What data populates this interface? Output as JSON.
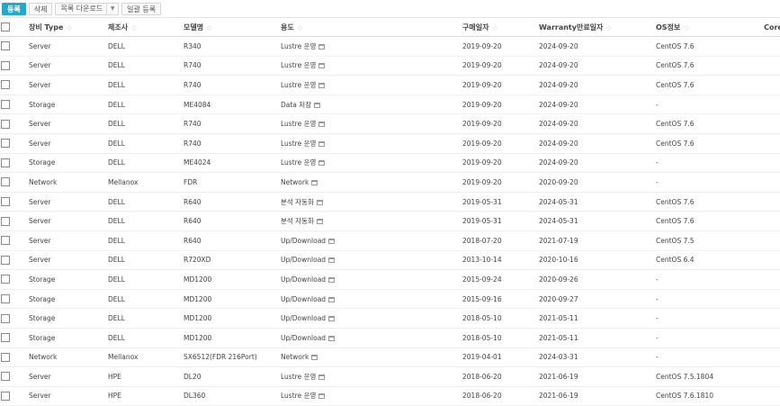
{
  "toolbar": {
    "register": "등록",
    "delete": "삭제",
    "download": "목록 다운로드",
    "bulk_register": "일괄 등록"
  },
  "columns": [
    "장비 Type",
    "제조사",
    "모델명",
    "용도",
    "구매일자",
    "Warranty만료일자",
    "OS정보",
    "Core 합"
  ],
  "rows": [
    {
      "type": "Server",
      "maker": "DELL",
      "model": "R340",
      "purpose": "Lustre 운영",
      "buy": "2019-09-20",
      "warranty": "2024-09-20",
      "os": "CentOS 7.6"
    },
    {
      "type": "Server",
      "maker": "DELL",
      "model": "R740",
      "purpose": "Lustre 운영",
      "buy": "2019-09-20",
      "warranty": "2024-09-20",
      "os": "CentOS 7.6"
    },
    {
      "type": "Server",
      "maker": "DELL",
      "model": "R740",
      "purpose": "Lustre 운영",
      "buy": "2019-09-20",
      "warranty": "2024-09-20",
      "os": "CentOS 7.6"
    },
    {
      "type": "Storage",
      "maker": "DELL",
      "model": "ME4084",
      "purpose": "Data 저장",
      "buy": "2019-09-20",
      "warranty": "2024-09-20",
      "os": "-"
    },
    {
      "type": "Server",
      "maker": "DELL",
      "model": "R740",
      "purpose": "Lustre 운영",
      "buy": "2019-09-20",
      "warranty": "2024-09-20",
      "os": "CentOS 7.6"
    },
    {
      "type": "Server",
      "maker": "DELL",
      "model": "R740",
      "purpose": "Lustre 운영",
      "buy": "2019-09-20",
      "warranty": "2024-09-20",
      "os": "CentOS 7.6"
    },
    {
      "type": "Storage",
      "maker": "DELL",
      "model": "ME4024",
      "purpose": "Lustre 운영",
      "buy": "2019-09-20",
      "warranty": "2024-09-20",
      "os": "-"
    },
    {
      "type": "Network",
      "maker": "Mellanox",
      "model": "FDR",
      "purpose": "Network",
      "buy": "2019-09-20",
      "warranty": "2020-09-20",
      "os": "-"
    },
    {
      "type": "Server",
      "maker": "DELL",
      "model": "R640",
      "purpose": "분석 자동화",
      "buy": "2019-05-31",
      "warranty": "2024-05-31",
      "os": "CentOS 7.6"
    },
    {
      "type": "Server",
      "maker": "DELL",
      "model": "R640",
      "purpose": "분석 자동화",
      "buy": "2019-05-31",
      "warranty": "2024-05-31",
      "os": "CentOS 7.6"
    },
    {
      "type": "Server",
      "maker": "DELL",
      "model": "R640",
      "purpose": "Up/Download",
      "buy": "2018-07-20",
      "warranty": "2021-07-19",
      "os": "CentOS 7.5"
    },
    {
      "type": "Server",
      "maker": "DELL",
      "model": "R720XD",
      "purpose": "Up/Download",
      "buy": "2013-10-14",
      "warranty": "2020-10-16",
      "os": "CentOS 6.4"
    },
    {
      "type": "Storage",
      "maker": "DELL",
      "model": "MD1200",
      "purpose": "Up/Download",
      "buy": "2015-09-24",
      "warranty": "2020-09-26",
      "os": "-"
    },
    {
      "type": "Storage",
      "maker": "DELL",
      "model": "MD1200",
      "purpose": "Up/Download",
      "buy": "2015-09-16",
      "warranty": "2020-09-27",
      "os": "-"
    },
    {
      "type": "Storage",
      "maker": "DELL",
      "model": "MD1200",
      "purpose": "Up/Download",
      "buy": "2018-05-10",
      "warranty": "2021-05-11",
      "os": "-"
    },
    {
      "type": "Storage",
      "maker": "DELL",
      "model": "MD1200",
      "purpose": "Up/Download",
      "buy": "2018-05-10",
      "warranty": "2021-05-11",
      "os": "-"
    },
    {
      "type": "Network",
      "maker": "Mellanox",
      "model": "SX6512(FDR 216Port)",
      "purpose": "Network",
      "buy": "2019-04-01",
      "warranty": "2024-03-31",
      "os": "-"
    },
    {
      "type": "Server",
      "maker": "HPE",
      "model": "DL20",
      "purpose": "Lustre 운영",
      "buy": "2018-06-20",
      "warranty": "2021-06-19",
      "os": "CentOS 7.5.1804"
    },
    {
      "type": "Server",
      "maker": "HPE",
      "model": "DL360",
      "purpose": "Lustre 운영",
      "buy": "2018-06-20",
      "warranty": "2021-06-19",
      "os": "CentOS 7.6.1810"
    }
  ]
}
